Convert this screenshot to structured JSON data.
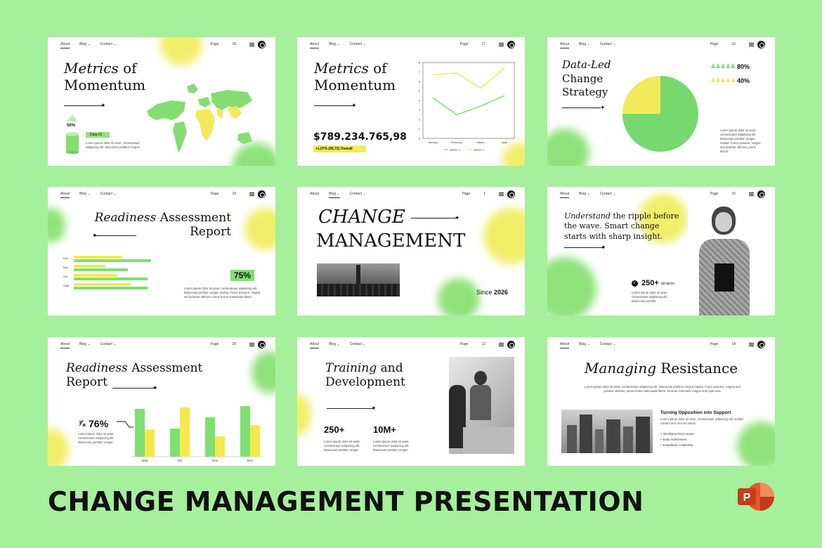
{
  "footer_title": "CHANGE MANAGEMENT PRESENTATION",
  "app_icon": "powerpoint-icon",
  "nav": {
    "about": "About",
    "blog": "Blog",
    "contact": "Contact",
    "page_label": "Page"
  },
  "slides": [
    {
      "page": "18",
      "title_italic": "Metrics",
      "title_rest": "of",
      "title_line2": "Momentum",
      "stat": "50%",
      "data_label": "Data 01",
      "body": "Lorem ipsum dolor sit amet, consectetuer adipiscing elit. Maecenas porttitor congue"
    },
    {
      "page": "17",
      "title_italic": "Metrics",
      "title_rest": "of",
      "title_line2": "Momentum",
      "amount": "$789.234.765,98",
      "change": "+1,07% (95,72) Overall",
      "chart_data": {
        "type": "line",
        "categories": [
          "January",
          "February",
          "March",
          "April"
        ],
        "series": [
          {
            "name": "Series 1",
            "values": [
              4.3,
              2.5,
              3.4,
              4.5
            ]
          },
          {
            "name": "Series 2",
            "values": [
              6.7,
              6.9,
              5.3,
              7.4
            ]
          }
        ],
        "ylim": [
          0,
          8
        ],
        "yticks": [
          "0",
          "1",
          "2",
          "3",
          "4",
          "5",
          "6",
          "7",
          "8"
        ],
        "colors": [
          "#77dd66",
          "#f3e94a"
        ]
      }
    },
    {
      "page": "16",
      "title_italic": "Data-Led",
      "title_line2": "Change",
      "title_line3": "Strategy",
      "stat_1": "80%",
      "stat_2": "40%",
      "body": "Lorem ipsum dolor sit amet, consectetuer adipiscing elit. Maecenas porttitor congue massa. Fusce posuere, magna sed pulvinar ultricies, purus lectus",
      "chart_data": {
        "type": "pie",
        "categories": [
          "Green",
          "Yellow"
        ],
        "values": [
          75,
          25
        ],
        "colors": [
          "#77d870",
          "#f1ea5a"
        ]
      }
    },
    {
      "page": "19",
      "title_italic": "Readiness",
      "title_rest": "Assessment",
      "title_line2": "Report",
      "stat": "75%",
      "body": "Lorem ipsum dolor sit amet, consectetuer adipiscing elit. Maecenas porttitor congue massa. Fusce posuere, magna sed pulvinar ultricies, purus lectus malesuada libero.",
      "chart_data": {
        "type": "bar",
        "categories": [
          "Dec",
          "Nov",
          "Oct",
          "Sept"
        ],
        "series": [
          {
            "values": [
              72,
              47,
              65,
              85
            ]
          },
          {
            "values": [
              115,
              80,
              110,
              110
            ]
          }
        ],
        "colors": [
          "#f3e94a",
          "#7fdf72"
        ]
      }
    },
    {
      "page": "1",
      "title_line1": "CHANGE",
      "title_line2": "MANAGEMENT",
      "since": "Since",
      "year": "2026"
    },
    {
      "page": "15",
      "title_italic": "Understand",
      "title_rest": "the ripple before",
      "title_line2": "the wave. Smart change",
      "title_line3": "starts with sharp insight.",
      "stat": "250+",
      "stat_unit": "/projects",
      "body": "Lorem ipsum dolor sit amet, consectetuer adipiscing elit. Maecenas porttitor"
    },
    {
      "page": "20",
      "title_italic": "Readiness",
      "title_rest": "Assessment",
      "title_line2": "Report",
      "stat": "76%",
      "body": "Lorem ipsum dolor sit amet, consectetuer adipiscing elit. Maecenas porttitor congue.",
      "chart_data": {
        "type": "bar",
        "categories": [
          "Sept",
          "Oct",
          "Nov",
          "Dec"
        ],
        "series": [
          {
            "values": [
              85,
              50,
              70,
              90
            ]
          },
          {
            "values": [
              48,
              88,
              36,
              56
            ]
          }
        ],
        "ylim": [
          0,
          100
        ],
        "colors": [
          "#7fdf72",
          "#f3e94a"
        ]
      }
    },
    {
      "page": "13",
      "title_italic": "Training",
      "title_rest": "and",
      "title_line2": "Development",
      "stat_1": "250+",
      "stat_2": "10M+",
      "body_1": "Lorem ipsum dolor sit amet, consectetuer adipiscing elit. Maecenas porttitor congue.",
      "body_2": "Lorem ipsum dolor sit amet, consectetuer adipiscing elit. Maecenas porttitor congue."
    },
    {
      "page": "14",
      "title_italic": "Managing",
      "title_rest": "Resistance",
      "intro": "Lorem ipsum dolor sit amet, consectetuer adipiscing elit. Maecenas porttitor congue massa. Fusce posuere, magna sed pulvinar ultricies, purus lectus malesuada libero, sit amet commodo magna eros quis urna.",
      "subtitle": "Turning Opposition into Support",
      "sub_body": "Lorem ipsum dolor sit amet, consectetuer adipiscing elit. Nullam cursum dum sed vel varius",
      "bullets": [
        "Identifying Root Causes",
        "Early Involvement",
        "Empathetic Leadership"
      ]
    }
  ]
}
